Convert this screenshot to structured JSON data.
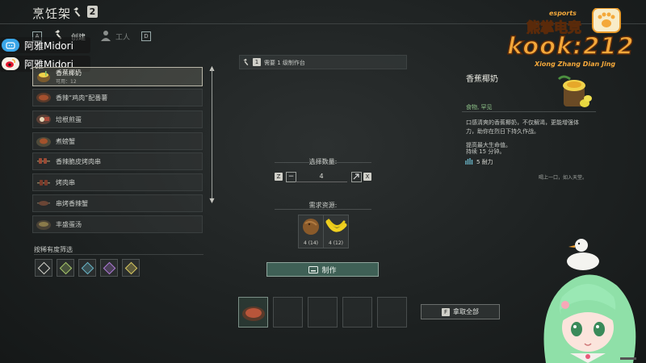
{
  "header": {
    "title": "烹饪架",
    "level_badge": "2",
    "tabs": [
      {
        "key": "A",
        "label": "创建"
      },
      {
        "key": "",
        "label": "工人"
      },
      {
        "key": "D",
        "label": ""
      }
    ]
  },
  "stream_tags": [
    {
      "name": "阿雅Midori",
      "platform": "bilibili-icon"
    },
    {
      "name": "阿雅Midori",
      "platform": "weibo-icon"
    }
  ],
  "recipes": [
    {
      "name": "香蕉椰奶",
      "sub": "可用：12",
      "selected": true
    },
    {
      "name": "香辣“鸡肉”配番薯",
      "sub": ""
    },
    {
      "name": "培根煎蛋",
      "sub": ""
    },
    {
      "name": "煮螃蟹",
      "sub": ""
    },
    {
      "name": "香辣脆皮烤肉串",
      "sub": ""
    },
    {
      "name": "烤肉串",
      "sub": ""
    },
    {
      "name": "串烤香辣蟹",
      "sub": ""
    },
    {
      "name": "丰盛蛋汤",
      "sub": ""
    }
  ],
  "filter": {
    "label": "按稀有度筛选",
    "colors": [
      "#d8d8d0",
      "#a8c86a",
      "#6ab6c8",
      "#b07ad8",
      "#d8c860"
    ]
  },
  "requirement": {
    "key": "1",
    "text": "需要 1 级制作台"
  },
  "quantity": {
    "label": "选择数量:",
    "value": "4",
    "key_left": "Z",
    "key_right": "X",
    "minus": "−"
  },
  "resources": {
    "label": "需求资源:",
    "items": [
      {
        "name": "coconut-icon",
        "qty": "4 (14)"
      },
      {
        "name": "banana-icon",
        "qty": "4 (12)"
      }
    ]
  },
  "craft_button": {
    "label": "制作"
  },
  "output": {
    "take_all_key": "F",
    "take_all_label": "拿取全部"
  },
  "detail": {
    "title": "香蕉椰奶",
    "category": "食物, 罕见",
    "description": "口感清爽的香蕉椰奶，不仅解渴，更能增强体力，助你在烈日下持久作战。",
    "stat_1": "提高最大生命值。",
    "stat_2": "持续 15 分钟。",
    "durability": "5 耐力",
    "flavor": "喝上一口，如入天堂。"
  },
  "logo": {
    "top": "esports",
    "brand_cn": "熊掌电竞",
    "main": "kook:212",
    "sub": "Xiong Zhang Dian Jing"
  },
  "colors": {
    "accent_green": "#3f6056",
    "category_green": "#8fc48a",
    "logo_orange": "#f4a83a"
  }
}
